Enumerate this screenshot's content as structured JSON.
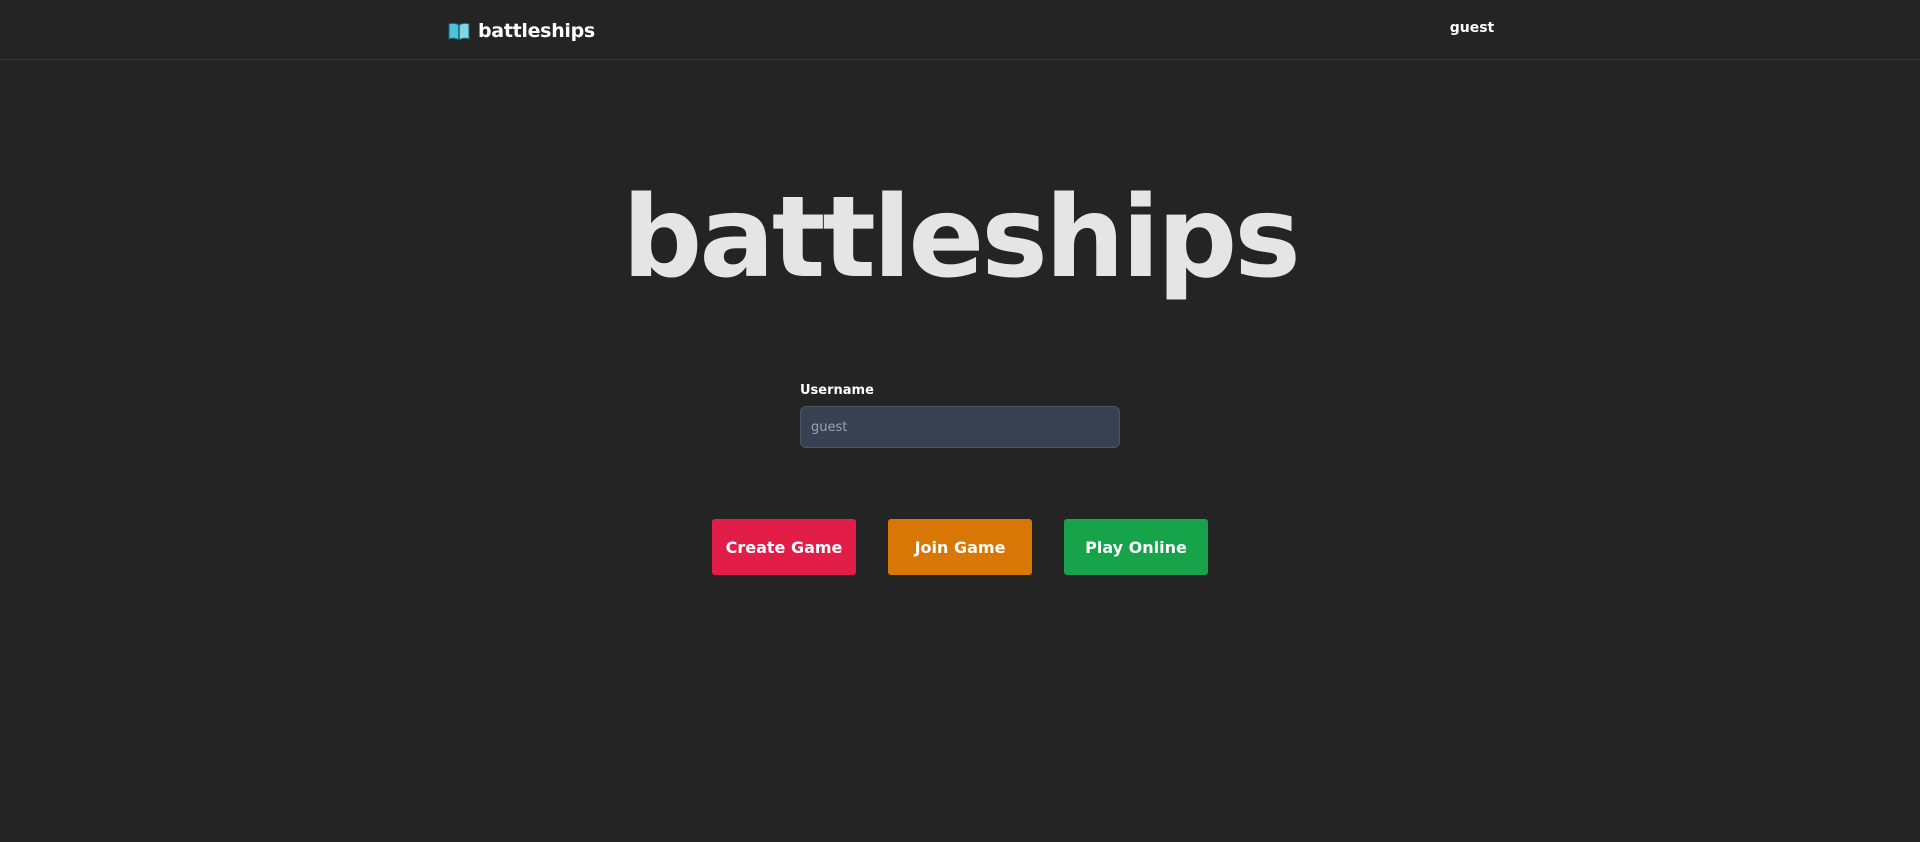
{
  "nav": {
    "brand": "battleships",
    "brand_icon": "book-icon",
    "user": "guest"
  },
  "hero": {
    "title": "battleships"
  },
  "form": {
    "username_label": "Username",
    "username_placeholder": "guest",
    "username_value": ""
  },
  "buttons": [
    {
      "label": "Create Game",
      "color": "#e11d48"
    },
    {
      "label": "Join Game",
      "color": "#d97706"
    },
    {
      "label": "Play Online",
      "color": "#16a34a"
    }
  ],
  "colors": {
    "background": "#242424",
    "input_bg": "#374151",
    "title": "#e5e5e5",
    "icon_accent": "#4fc3d9"
  }
}
